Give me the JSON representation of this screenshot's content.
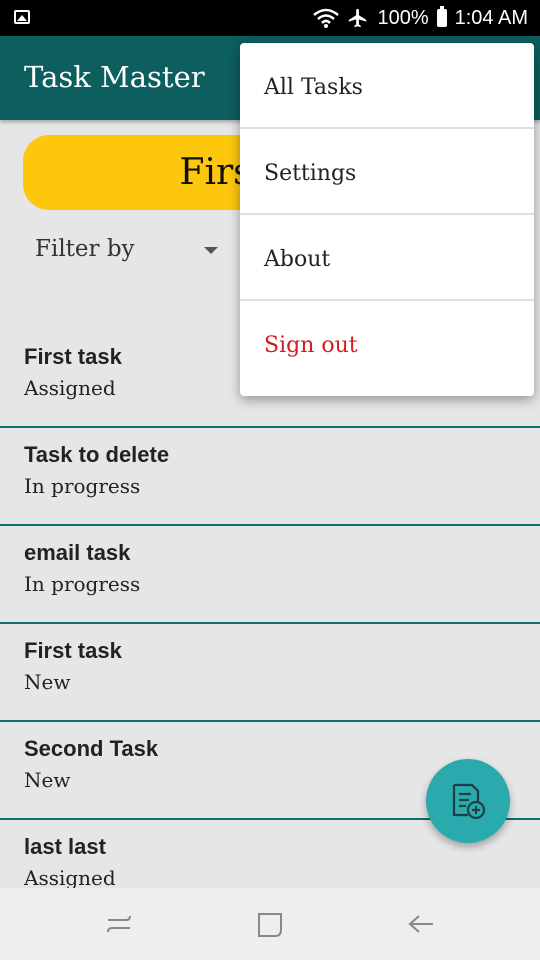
{
  "status_bar": {
    "battery": "100%",
    "time": "1:04 AM",
    "icons": [
      "gallery-icon",
      "wifi-icon",
      "airplane-icon",
      "battery-icon"
    ]
  },
  "app_bar": {
    "title": "Task Master"
  },
  "main": {
    "primary_button_label": "First Task",
    "filter_label": "Filter by"
  },
  "tasks": [
    {
      "title": "First task",
      "status": "Assigned"
    },
    {
      "title": "Task to delete",
      "status": "In progress"
    },
    {
      "title": "email task",
      "status": "In progress"
    },
    {
      "title": "First task",
      "status": "New"
    },
    {
      "title": "Second Task",
      "status": "New"
    },
    {
      "title": "last last",
      "status": "Assigned"
    }
  ],
  "menu": {
    "items": [
      {
        "label": "All Tasks"
      },
      {
        "label": "Settings"
      },
      {
        "label": "About"
      },
      {
        "label": "Sign out"
      }
    ]
  },
  "fab": {
    "icon": "add-note-icon"
  },
  "nav_bar": {
    "icons": [
      "recents-icon",
      "home-icon",
      "back-icon"
    ]
  },
  "colors": {
    "app_bar": "#0d5e5e",
    "accent_yellow": "#fcc70c",
    "fab": "#2aaaad",
    "danger": "#d81b1b",
    "divider": "#0d6e6e"
  }
}
